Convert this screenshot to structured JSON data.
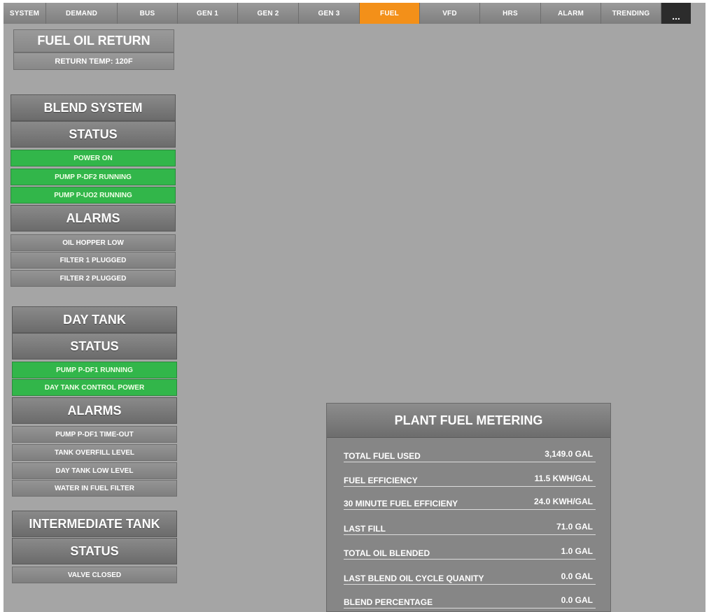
{
  "nav": {
    "tabs": [
      {
        "label": "SYSTEM",
        "active": false
      },
      {
        "label": "DEMAND",
        "active": false
      },
      {
        "label": "BUS",
        "active": false
      },
      {
        "label": "GEN 1",
        "active": false
      },
      {
        "label": "GEN 2",
        "active": false
      },
      {
        "label": "GEN 3",
        "active": false
      },
      {
        "label": "FUEL",
        "active": true
      },
      {
        "label": "VFD",
        "active": false
      },
      {
        "label": "HRS",
        "active": false
      },
      {
        "label": "ALARM",
        "active": false
      },
      {
        "label": "TRENDING",
        "active": false
      }
    ],
    "more_label": "..."
  },
  "fuel_oil_return": {
    "title": "FUEL OIL RETURN",
    "return_temp": "RETURN TEMP:   120F"
  },
  "blend_system": {
    "title": "BLEND SYSTEM",
    "status_title": "STATUS",
    "status_items": [
      "POWER ON",
      "PUMP P-DF2 RUNNING",
      "PUMP P-UO2 RUNNING"
    ],
    "alarms_title": "ALARMS",
    "alarm_items": [
      "OIL HOPPER LOW",
      "FILTER 1 PLUGGED",
      "FILTER 2 PLUGGED"
    ]
  },
  "day_tank": {
    "title": "DAY TANK",
    "status_title": "STATUS",
    "status_items": [
      "PUMP P-DF1 RUNNING",
      "DAY TANK CONTROL POWER"
    ],
    "alarms_title": "ALARMS",
    "alarm_items": [
      "PUMP P-DF1 TIME-OUT",
      "TANK OVERFILL LEVEL",
      "DAY TANK LOW LEVEL",
      "WATER IN FUEL FILTER"
    ]
  },
  "intermediate_tank": {
    "title": "INTERMEDIATE TANK",
    "status_title": "STATUS",
    "status_items": [
      "VALVE CLOSED"
    ]
  },
  "plant_fuel_metering": {
    "title": "PLANT FUEL METERING",
    "rows": [
      {
        "label": "TOTAL FUEL USED",
        "value": "3,149.0 GAL"
      },
      {
        "label": "FUEL EFFICIENCY",
        "value": "11.5 KWH/GAL"
      },
      {
        "label": "30 MINUTE FUEL EFFICIENY",
        "value": "24.0 KWH/GAL"
      },
      {
        "label": "LAST FILL",
        "value": "71.0 GAL"
      },
      {
        "label": "TOTAL OIL BLENDED",
        "value": "1.0 GAL"
      },
      {
        "label": "LAST BLEND OIL CYCLE QUANITY",
        "value": "0.0 GAL"
      },
      {
        "label": "BLEND PERCENTAGE",
        "value": "0.0 GAL"
      }
    ]
  },
  "colors": {
    "active_tab": "#f39019",
    "status_on": "#32b64a",
    "background": "#a5a5a5"
  }
}
